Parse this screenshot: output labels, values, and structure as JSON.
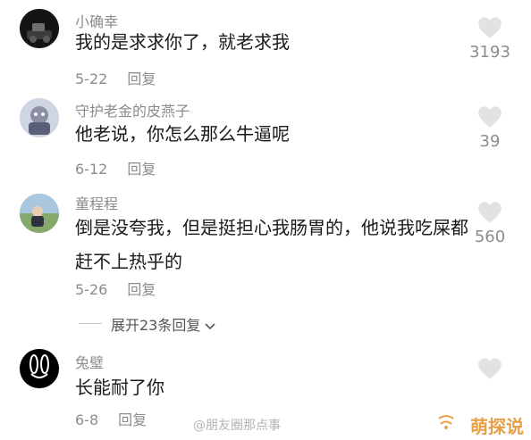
{
  "comments": [
    {
      "username": "小确幸",
      "text": "我的是求求你了，就老求我",
      "date": "5-22",
      "reply_label": "回复",
      "likes": "3193",
      "avatar_icon": "avatar-icon"
    },
    {
      "username": "守护老金的皮燕子",
      "text": "他老说，你怎么那么牛逼呢",
      "date": "6-12",
      "reply_label": "回复",
      "likes": "39",
      "avatar_icon": "avatar-icon"
    },
    {
      "username": "童程程",
      "text": "倒是没夸我，但是挺担心我肠胃的，他说我吃屎都赶不上热乎的",
      "date": "5-26",
      "reply_label": "回复",
      "likes": "560",
      "avatar_icon": "avatar-icon"
    },
    {
      "username": "兔璧",
      "text": "长能耐了你",
      "date": "6-8",
      "reply_label": "回复",
      "likes": "",
      "avatar_icon": "rabbit-avatar-icon"
    }
  ],
  "expand_replies": {
    "label": "展开23条回复"
  },
  "watermark": "@朋友圈那点事",
  "brand": {
    "label": "萌探说",
    "icon": "brand-logo-icon"
  },
  "colors": {
    "text": "#1a1a1a",
    "meta": "#8c8c8c",
    "heart": "#e2e2e2",
    "brand": "#e7a046"
  }
}
